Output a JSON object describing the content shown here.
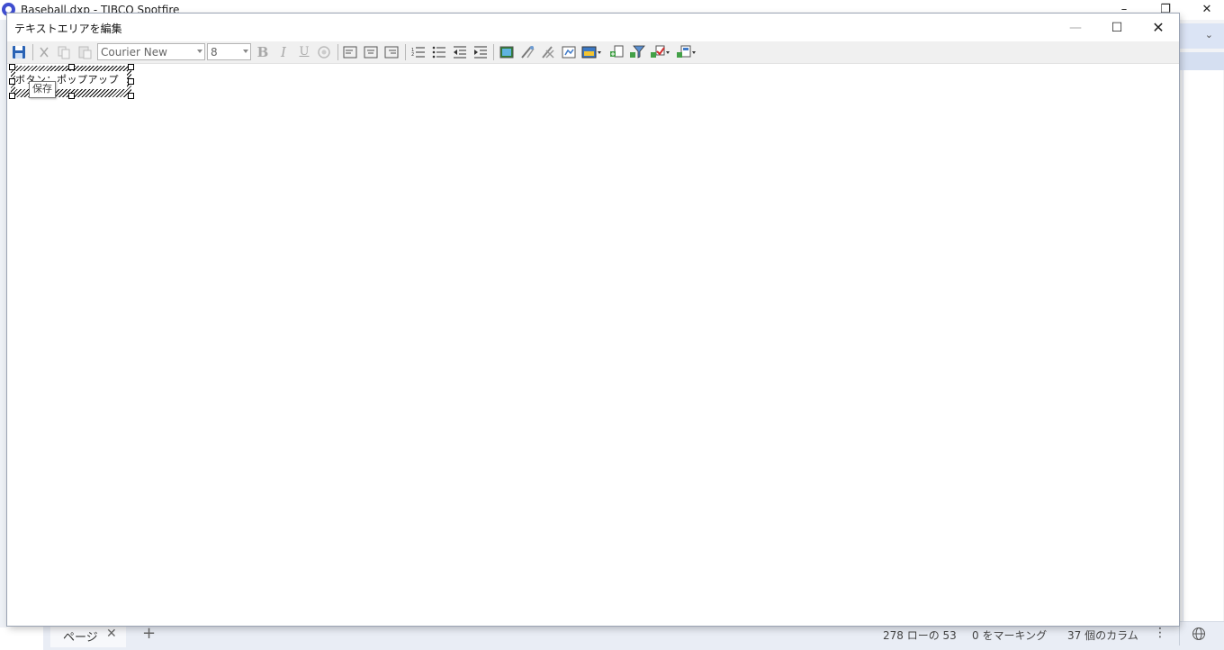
{
  "app": {
    "title": "Baseball.dxp - TIBCO Spotfire",
    "minimize": "–",
    "restore": "❐",
    "close": "✕"
  },
  "dialog": {
    "title": "テキストエリアを編集",
    "minimize": "—",
    "maximize": "☐",
    "close": "✕"
  },
  "toolbar": {
    "font_family": "Courier New",
    "font_size": "8",
    "bold": "B",
    "italic": "I",
    "underline": "U",
    "icons": [
      "save-icon",
      "cut-icon",
      "copy-icon",
      "paste-icon",
      "color-icon",
      "align-left-icon",
      "align-center-icon",
      "align-right-icon",
      "numbered-list-icon",
      "bullet-list-icon",
      "outdent-icon",
      "indent-icon",
      "image-icon",
      "action-link-icon",
      "remove-link-icon",
      "property-control-icon",
      "insert-table-icon",
      "insert-control-icon",
      "filter-icon",
      "marking-icon",
      "more-controls-icon"
    ]
  },
  "editor": {
    "control_text": "ボタン：ポップアップ",
    "tooltip": "保存"
  },
  "statusbar": {
    "page_tab": "ページ",
    "page_tab_close": "✕",
    "add_page": "+",
    "rows": "278 ローの 53",
    "marking": "0 をマーキング",
    "columns": "37 個のカラム",
    "more": "⋮"
  }
}
